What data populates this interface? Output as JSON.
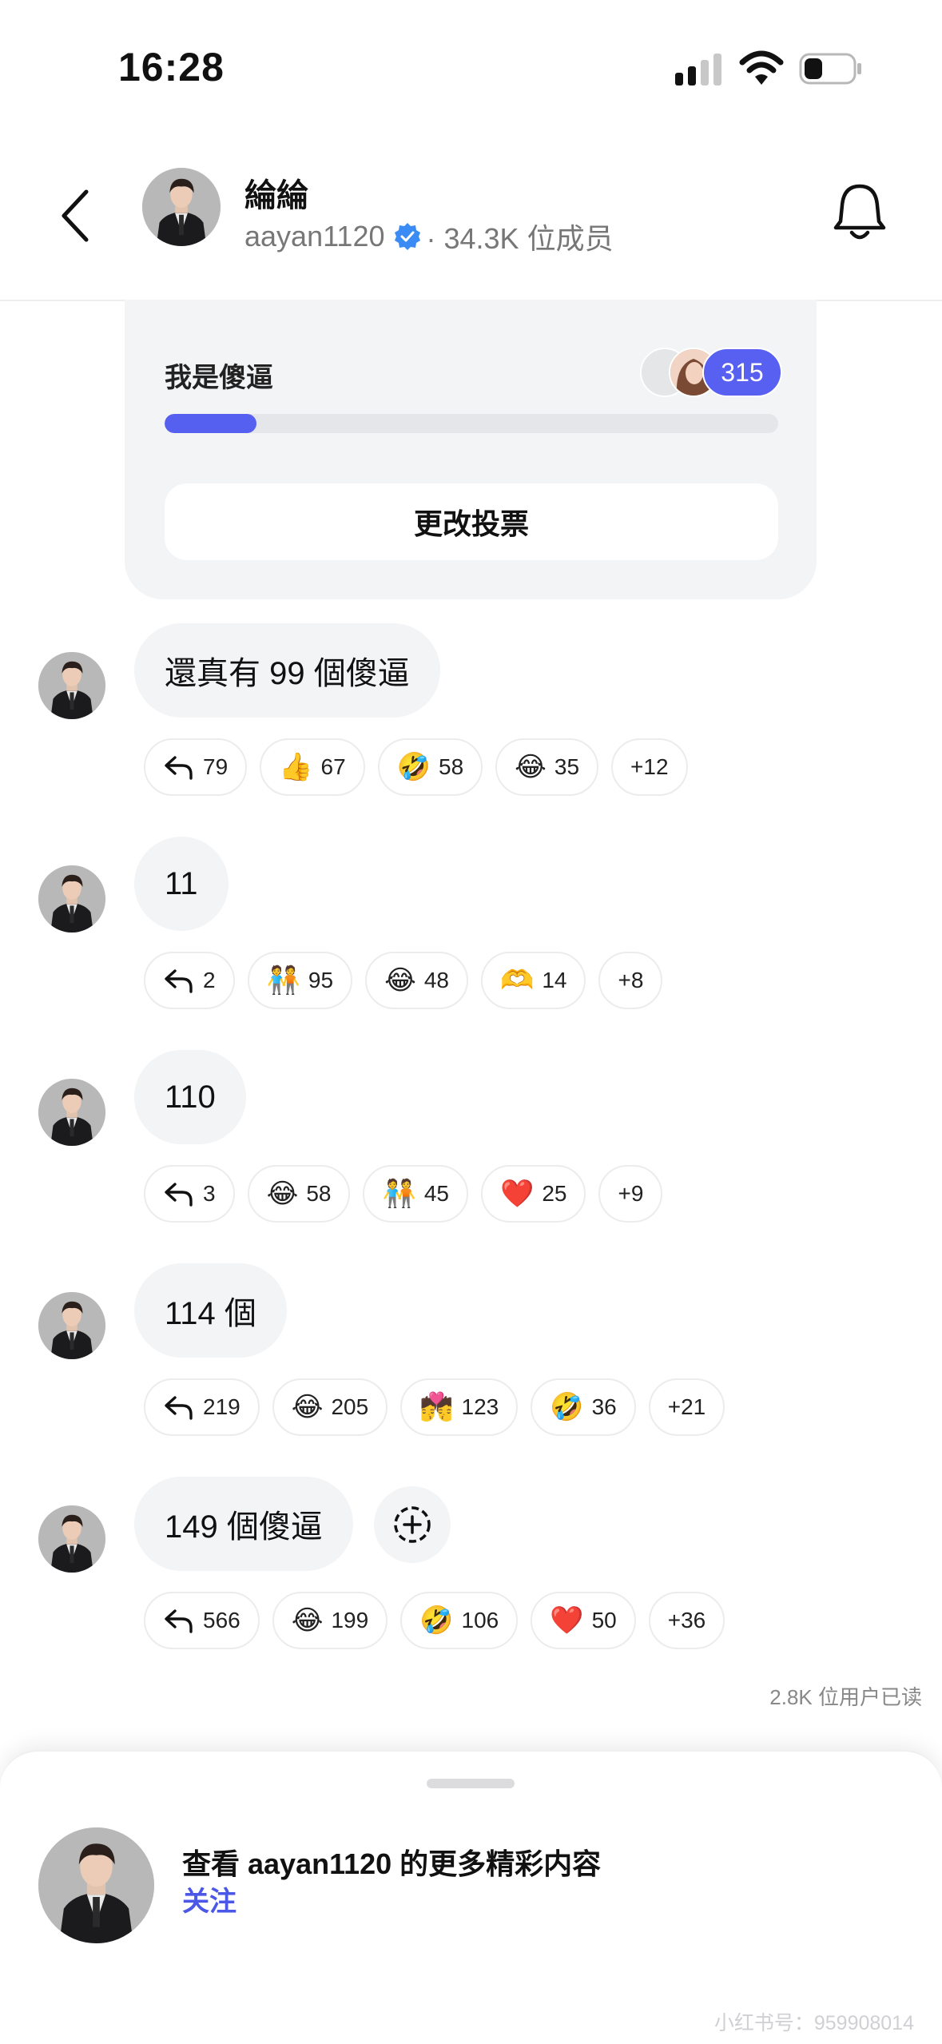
{
  "status_bar": {
    "time": "16:28"
  },
  "header": {
    "title": "綸綸",
    "username": "aayan1120",
    "members": "· 34.3K 位成员"
  },
  "poll": {
    "option_label": "我是傻逼",
    "votes": "315",
    "fill_fraction": 0.15,
    "change_vote_label": "更改投票"
  },
  "messages": [
    {
      "text": "還真有 99 個傻逼",
      "reply_count": "79",
      "reactions": [
        {
          "emoji": "👍",
          "count": "67"
        },
        {
          "emoji": "🤣",
          "count": "58"
        },
        {
          "emoji": "😂",
          "count": "35"
        }
      ],
      "more": "+12"
    },
    {
      "text": "11",
      "reply_count": "2",
      "reactions": [
        {
          "emoji": "🧑‍🤝‍🧑",
          "count": "95"
        },
        {
          "emoji": "😂",
          "count": "48"
        },
        {
          "emoji": "🫶",
          "count": "14"
        }
      ],
      "more": "+8"
    },
    {
      "text": "110",
      "reply_count": "3",
      "reactions": [
        {
          "emoji": "😂",
          "count": "58"
        },
        {
          "emoji": "🧑‍🤝‍🧑",
          "count": "45"
        },
        {
          "emoji": "❤️",
          "count": "25"
        }
      ],
      "more": "+9"
    },
    {
      "text": "114 個",
      "reply_count": "219",
      "reactions": [
        {
          "emoji": "😂",
          "count": "205"
        },
        {
          "emoji": "💏",
          "count": "123"
        },
        {
          "emoji": "🤣",
          "count": "36"
        }
      ],
      "more": "+21"
    },
    {
      "text": "149 個傻逼",
      "reply_count": "566",
      "reactions": [
        {
          "emoji": "😂",
          "count": "199"
        },
        {
          "emoji": "🤣",
          "count": "106"
        },
        {
          "emoji": "❤️",
          "count": "50"
        }
      ],
      "more": "+36"
    }
  ],
  "read_status": "2.8K 位用户已读",
  "bottom_sheet": {
    "text": "查看 aayan1120 的更多精彩内容",
    "follow_label": "关注"
  },
  "watermark": "小红书号：959908014",
  "icons": {
    "back": "back-arrow-icon",
    "verified": "verified-badge-icon",
    "bell": "bell-icon",
    "reply": "reply-arrow-icon",
    "add_reaction": "add-reaction-icon"
  },
  "colors": {
    "accent": "#5660f0",
    "follow": "#4b57e6",
    "verified": "#3b8bf5",
    "bubble": "#f3f4f6"
  }
}
